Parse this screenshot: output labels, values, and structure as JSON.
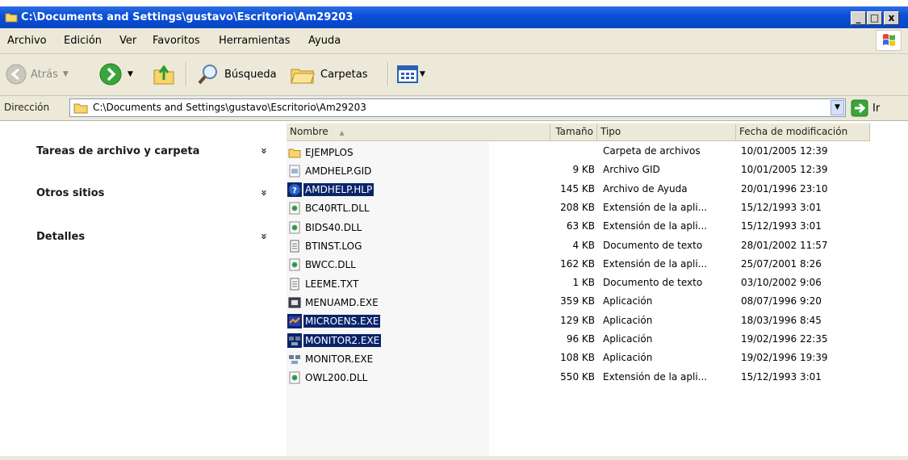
{
  "window": {
    "title": "C:\\Documents and Settings\\gustavo\\Escritorio\\Am29203",
    "controls": {
      "minimize": "_",
      "maximize": "□",
      "close": "x"
    }
  },
  "menu": [
    "Archivo",
    "Edición",
    "Ver",
    "Favoritos",
    "Herramientas",
    "Ayuda"
  ],
  "toolbar": {
    "back": "Atrás",
    "search": "Búsqueda",
    "folders": "Carpetas"
  },
  "address": {
    "label": "Dirección",
    "value": "C:\\Documents and Settings\\gustavo\\Escritorio\\Am29203",
    "go": "Ir"
  },
  "tasks": [
    {
      "label": "Tareas de archivo y carpeta",
      "chevron": "»"
    },
    {
      "label": "Otros sitios",
      "chevron": "»"
    },
    {
      "label": "Detalles",
      "chevron": "»"
    }
  ],
  "columns": {
    "name": "Nombre",
    "sort_arrow": "▲",
    "size": "Tamaño",
    "type": "Tipo",
    "date": "Fecha de modificación"
  },
  "files": [
    {
      "name": "EJEMPLOS",
      "size": "",
      "type": "Carpeta de archivos",
      "date": "10/01/2005 12:39",
      "icon": "folder-icon",
      "selected": false
    },
    {
      "name": "AMDHELP.GID",
      "size": "9 KB",
      "type": "Archivo GID",
      "date": "10/01/2005 12:39",
      "icon": "gid-file-icon",
      "selected": false
    },
    {
      "name": "AMDHELP.HLP",
      "size": "145 KB",
      "type": "Archivo de Ayuda",
      "date": "20/01/1996 23:10",
      "icon": "help-file-icon",
      "selected": true
    },
    {
      "name": "BC40RTL.DLL",
      "size": "208 KB",
      "type": "Extensión de la apli...",
      "date": "15/12/1993 3:01",
      "icon": "dll-file-icon",
      "selected": false
    },
    {
      "name": "BIDS40.DLL",
      "size": "63 KB",
      "type": "Extensión de la apli...",
      "date": "15/12/1993 3:01",
      "icon": "dll-file-icon",
      "selected": false
    },
    {
      "name": "BTINST.LOG",
      "size": "4 KB",
      "type": "Documento de texto",
      "date": "28/01/2002 11:57",
      "icon": "text-file-icon",
      "selected": false
    },
    {
      "name": "BWCC.DLL",
      "size": "162 KB",
      "type": "Extensión de la apli...",
      "date": "25/07/2001 8:26",
      "icon": "dll-file-icon",
      "selected": false
    },
    {
      "name": "LEEME.TXT",
      "size": "1 KB",
      "type": "Documento de texto",
      "date": "03/10/2002 9:06",
      "icon": "text-file-icon",
      "selected": false
    },
    {
      "name": "MENUAMD.EXE",
      "size": "359 KB",
      "type": "Aplicación",
      "date": "08/07/1996 9:20",
      "icon": "exe-file-icon",
      "selected": false
    },
    {
      "name": "MICROENS.EXE",
      "size": "129 KB",
      "type": "Aplicación",
      "date": "18/03/1996 8:45",
      "icon": "exe-app-icon",
      "selected": true
    },
    {
      "name": "MONITOR2.EXE",
      "size": "96 KB",
      "type": "Aplicación",
      "date": "19/02/1996 22:35",
      "icon": "monitor-app-icon",
      "selected": true
    },
    {
      "name": "MONITOR.EXE",
      "size": "108 KB",
      "type": "Aplicación",
      "date": "19/02/1996 19:39",
      "icon": "monitor-app-icon",
      "selected": false
    },
    {
      "name": "OWL200.DLL",
      "size": "550 KB",
      "type": "Extensión de la apli...",
      "date": "15/12/1993 3:01",
      "icon": "dll-file-icon",
      "selected": false
    }
  ]
}
